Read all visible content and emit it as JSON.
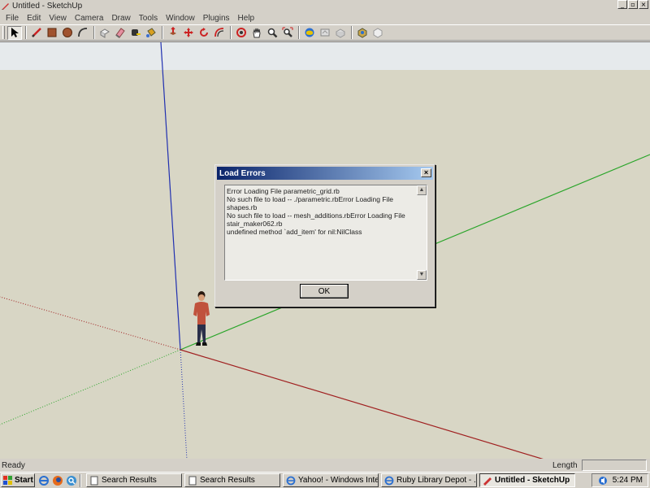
{
  "window": {
    "title": "Untitled - SketchUp",
    "controls": {
      "minimize": "_",
      "maximize": "▫",
      "close": "×"
    }
  },
  "menu": [
    "File",
    "Edit",
    "View",
    "Camera",
    "Draw",
    "Tools",
    "Window",
    "Plugins",
    "Help"
  ],
  "toolbar": {
    "tools": [
      "select-icon",
      "line-icon",
      "rectangle-icon",
      "circle-icon",
      "arc-icon",
      "make-component-icon",
      "eraser-icon",
      "tape-measure-icon",
      "paint-bucket-icon",
      "push-pull-icon",
      "move-icon",
      "rotate-icon",
      "offset-icon",
      "orbit-icon",
      "pan-icon",
      "zoom-icon",
      "zoom-extents-icon",
      "get-models-icon",
      "share-model-icon",
      "share-component-icon",
      "google-earth-icon",
      "google-earth-alt-icon"
    ],
    "active_tool": "select-icon"
  },
  "dialog": {
    "title": "Load Errors",
    "close": "×",
    "lines": [
      "Error Loading File parametric_grid.rb",
      "No such file to load -- ./parametric.rbError Loading File",
      "shapes.rb",
      "No such file to load -- mesh_additions.rbError Loading File",
      "stair_maker062.rb",
      "undefined method `add_item' for nil:NilClass"
    ],
    "ok_label": "OK"
  },
  "statusbar": {
    "status": "Ready",
    "length_label": "Length",
    "length_value": ""
  },
  "taskbar": {
    "start_label": "Start",
    "quick_launch": [
      "internet-explorer-icon",
      "firefox-icon",
      "search-icon"
    ],
    "tasks": [
      {
        "label": "Search Results",
        "active": false
      },
      {
        "label": "Search Results",
        "active": false
      },
      {
        "label": "Yahoo! - Windows Inte...",
        "active": false
      },
      {
        "label": "Ruby Library Depot - ...",
        "active": false
      },
      {
        "label": "Untitled - SketchUp",
        "active": true
      }
    ],
    "clock": "5:24 PM"
  },
  "colors": {
    "sky": "#e6eaec",
    "ground": "#d8d6c5",
    "axis_red": "#a02020",
    "axis_green": "#2aa52a",
    "axis_blue": "#2030b0",
    "dialog_title_start": "#0a246a",
    "dialog_title_end": "#a6caf0"
  }
}
